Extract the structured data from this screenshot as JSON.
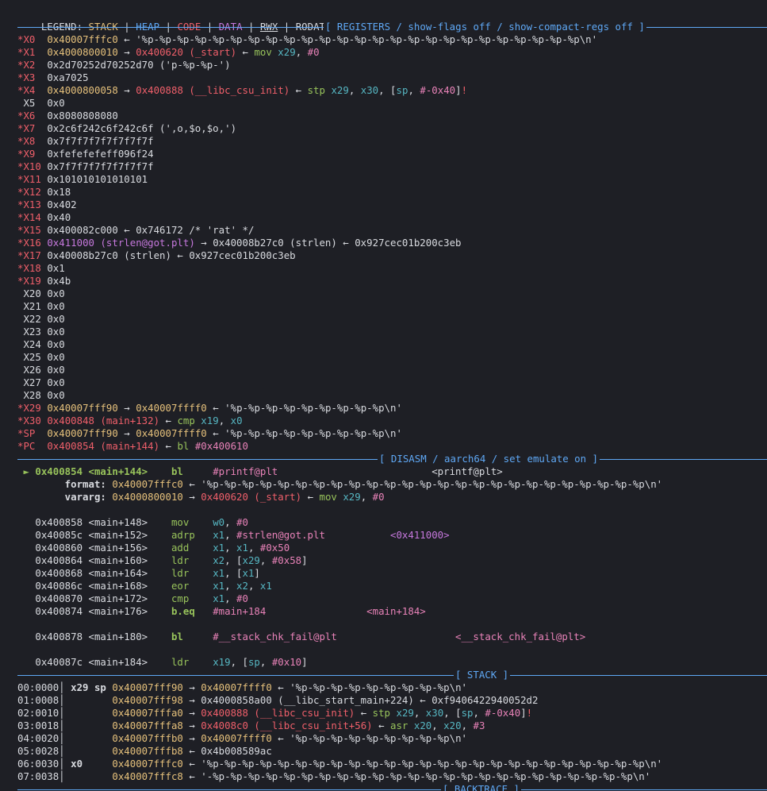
{
  "legend": {
    "label": "LEGEND: ",
    "items": [
      {
        "text": "STACK",
        "color": "#e5c07b"
      },
      {
        "text": "HEAP",
        "color": "#5fa8f5"
      },
      {
        "text": "CODE",
        "color": "#ef5f6a"
      },
      {
        "text": "DATA",
        "color": "#c678dd"
      },
      {
        "text": "RWX",
        "color": "#d9dbe0"
      },
      {
        "text": "RODATA",
        "color": "#d9dbe0"
      }
    ],
    "divider": " | "
  },
  "sections": {
    "registers": "[ REGISTERS / show-flags off / show-compact-regs off ]",
    "disasm": "[ DISASM / aarch64 / set emulate on ]",
    "stack": "[ STACK ]",
    "backtrace": "[ BACKTRACE ]"
  },
  "registers": [
    [
      [
        "*X0  ",
        "red"
      ],
      [
        "0x40007fffc0",
        "yellow"
      ],
      [
        " ← '%p-%p-%p-%p-%p-%p-%p-%p-%p-%p-%p-%p-%p-%p-%p-%p-%p-%p-%p-%p-%p-%p-%p-%p-%p\\n'",
        "white"
      ]
    ],
    [
      [
        "*X1  ",
        "red"
      ],
      [
        "0x4000800010",
        "yellow"
      ],
      [
        " → ",
        "white"
      ],
      [
        "0x400620 (_start)",
        "red"
      ],
      [
        " ← ",
        "white"
      ],
      [
        "mov ",
        "green"
      ],
      [
        "x29",
        "cyan"
      ],
      [
        ", ",
        "white"
      ],
      [
        "#0",
        "pink"
      ]
    ],
    [
      [
        "*X2  ",
        "red"
      ],
      [
        "0x2d70252d70252d70 ('p-%p-%p-')",
        "white"
      ]
    ],
    [
      [
        "*X3  ",
        "red"
      ],
      [
        "0xa7025",
        "white"
      ]
    ],
    [
      [
        "*X4  ",
        "red"
      ],
      [
        "0x4000800058",
        "yellow"
      ],
      [
        " → ",
        "white"
      ],
      [
        "0x400888 (__libc_csu_init)",
        "red"
      ],
      [
        " ← ",
        "white"
      ],
      [
        "stp ",
        "green"
      ],
      [
        "x29",
        "cyan"
      ],
      [
        ", ",
        "white"
      ],
      [
        "x30",
        "cyan"
      ],
      [
        ", [",
        "white"
      ],
      [
        "sp",
        "cyan"
      ],
      [
        ", ",
        "white"
      ],
      [
        "#-0x40",
        "pink"
      ],
      [
        "]",
        "white"
      ],
      [
        "!",
        "red"
      ]
    ],
    [
      [
        " X5  ",
        "white"
      ],
      [
        "0x0",
        "white"
      ]
    ],
    [
      [
        "*X6  ",
        "red"
      ],
      [
        "0x8080808080",
        "white"
      ]
    ],
    [
      [
        "*X7  ",
        "red"
      ],
      [
        "0x2c6f242c6f242c6f (',o,$o,$o,')",
        "white"
      ]
    ],
    [
      [
        "*X8  ",
        "red"
      ],
      [
        "0x7f7f7f7f7f7f7f7f",
        "white"
      ]
    ],
    [
      [
        "*X9  ",
        "red"
      ],
      [
        "0xfefefefeff096f24",
        "white"
      ]
    ],
    [
      [
        "*X10 ",
        "red"
      ],
      [
        "0x7f7f7f7f7f7f7f7f",
        "white"
      ]
    ],
    [
      [
        "*X11 ",
        "red"
      ],
      [
        "0x101010101010101",
        "white"
      ]
    ],
    [
      [
        "*X12 ",
        "red"
      ],
      [
        "0x18",
        "white"
      ]
    ],
    [
      [
        "*X13 ",
        "red"
      ],
      [
        "0x402",
        "white"
      ]
    ],
    [
      [
        "*X14 ",
        "red"
      ],
      [
        "0x40",
        "white"
      ]
    ],
    [
      [
        "*X15 ",
        "red"
      ],
      [
        "0x400082c000 ← 0x746172 /* 'rat' */",
        "white"
      ]
    ],
    [
      [
        "*X16 ",
        "red"
      ],
      [
        "0x411000 (strlen@got.plt)",
        "purple"
      ],
      [
        " → 0x40008b27c0 (strlen) ← 0x927cec01b200c3eb",
        "white"
      ]
    ],
    [
      [
        "*X17 ",
        "red"
      ],
      [
        "0x40008b27c0 (strlen) ← 0x927cec01b200c3eb",
        "white"
      ]
    ],
    [
      [
        "*X18 ",
        "red"
      ],
      [
        "0x1",
        "white"
      ]
    ],
    [
      [
        "*X19 ",
        "red"
      ],
      [
        "0x4b",
        "white"
      ]
    ],
    [
      [
        " X20 ",
        "white"
      ],
      [
        "0x0",
        "white"
      ]
    ],
    [
      [
        " X21 ",
        "white"
      ],
      [
        "0x0",
        "white"
      ]
    ],
    [
      [
        " X22 ",
        "white"
      ],
      [
        "0x0",
        "white"
      ]
    ],
    [
      [
        " X23 ",
        "white"
      ],
      [
        "0x0",
        "white"
      ]
    ],
    [
      [
        " X24 ",
        "white"
      ],
      [
        "0x0",
        "white"
      ]
    ],
    [
      [
        " X25 ",
        "white"
      ],
      [
        "0x0",
        "white"
      ]
    ],
    [
      [
        " X26 ",
        "white"
      ],
      [
        "0x0",
        "white"
      ]
    ],
    [
      [
        " X27 ",
        "white"
      ],
      [
        "0x0",
        "white"
      ]
    ],
    [
      [
        " X28 ",
        "white"
      ],
      [
        "0x0",
        "white"
      ]
    ],
    [
      [
        "*X29 ",
        "red"
      ],
      [
        "0x40007fff90",
        "yellow"
      ],
      [
        " → ",
        "white"
      ],
      [
        "0x40007ffff0",
        "yellow"
      ],
      [
        " ← '%p-%p-%p-%p-%p-%p-%p-%p-%p\\n'",
        "white"
      ]
    ],
    [
      [
        "*X30 ",
        "red"
      ],
      [
        "0x400848 (main+132)",
        "red"
      ],
      [
        " ← ",
        "white"
      ],
      [
        "cmp ",
        "green"
      ],
      [
        "x19",
        "cyan"
      ],
      [
        ", ",
        "white"
      ],
      [
        "x0",
        "cyan"
      ]
    ],
    [
      [
        "*SP  ",
        "red"
      ],
      [
        "0x40007fff90",
        "yellow"
      ],
      [
        " → ",
        "white"
      ],
      [
        "0x40007ffff0",
        "yellow"
      ],
      [
        " ← '%p-%p-%p-%p-%p-%p-%p-%p-%p\\n'",
        "white"
      ]
    ],
    [
      [
        "*PC  ",
        "red"
      ],
      [
        "0x400854 (main+144)",
        "red"
      ],
      [
        " ← ",
        "white"
      ],
      [
        "bl ",
        "green"
      ],
      [
        "#0x400610",
        "pink"
      ]
    ]
  ],
  "disasm": [
    {
      "segs": [
        [
          " ► 0x400854 <main+144>    bl     ",
          "green-bold"
        ],
        [
          "#printf@plt",
          "pink"
        ],
        [
          "                          ",
          "white"
        ],
        [
          "<printf@plt>",
          "white"
        ]
      ]
    },
    {
      "segs": [
        [
          "        format: ",
          "white-bold"
        ],
        [
          "0x40007fffc0",
          "yellow"
        ],
        [
          " ← '%p-%p-%p-%p-%p-%p-%p-%p-%p-%p-%p-%p-%p-%p-%p-%p-%p-%p-%p-%p-%p-%p-%p-%p-%p\\n'",
          "white"
        ]
      ]
    },
    {
      "segs": [
        [
          "        vararg: ",
          "white-bold"
        ],
        [
          "0x4000800010",
          "yellow"
        ],
        [
          " → ",
          "white"
        ],
        [
          "0x400620 (_start)",
          "red"
        ],
        [
          " ← ",
          "white"
        ],
        [
          "mov ",
          "green"
        ],
        [
          "x29",
          "cyan"
        ],
        [
          ", ",
          "white"
        ],
        [
          "#0",
          "pink"
        ]
      ]
    },
    {
      "segs": []
    },
    {
      "segs": [
        [
          "   0x400858 <main+148>    ",
          "white"
        ],
        [
          "mov    ",
          "green"
        ],
        [
          "w0",
          "cyan"
        ],
        [
          ", ",
          "white"
        ],
        [
          "#0",
          "pink"
        ]
      ]
    },
    {
      "segs": [
        [
          "   0x40085c <main+152>    ",
          "white"
        ],
        [
          "adrp   ",
          "green"
        ],
        [
          "x1",
          "cyan"
        ],
        [
          ", ",
          "white"
        ],
        [
          "#strlen@got.plt",
          "pink"
        ],
        [
          "           ",
          "white"
        ],
        [
          "<0x411000>",
          "purple"
        ]
      ]
    },
    {
      "segs": [
        [
          "   0x400860 <main+156>    ",
          "white"
        ],
        [
          "add    ",
          "green"
        ],
        [
          "x1",
          "cyan"
        ],
        [
          ", ",
          "white"
        ],
        [
          "x1",
          "cyan"
        ],
        [
          ", ",
          "white"
        ],
        [
          "#0x50",
          "pink"
        ]
      ]
    },
    {
      "segs": [
        [
          "   0x400864 <main+160>    ",
          "white"
        ],
        [
          "ldr    ",
          "green"
        ],
        [
          "x2",
          "cyan"
        ],
        [
          ", [",
          "white"
        ],
        [
          "x29",
          "cyan"
        ],
        [
          ", ",
          "white"
        ],
        [
          "#0x58",
          "pink"
        ],
        [
          "]",
          "white"
        ]
      ]
    },
    {
      "segs": [
        [
          "   0x400868 <main+164>    ",
          "white"
        ],
        [
          "ldr    ",
          "green"
        ],
        [
          "x1",
          "cyan"
        ],
        [
          ", [",
          "white"
        ],
        [
          "x1",
          "cyan"
        ],
        [
          "]",
          "white"
        ]
      ]
    },
    {
      "segs": [
        [
          "   0x40086c <main+168>    ",
          "white"
        ],
        [
          "eor    ",
          "green"
        ],
        [
          "x1",
          "cyan"
        ],
        [
          ", ",
          "white"
        ],
        [
          "x2",
          "cyan"
        ],
        [
          ", ",
          "white"
        ],
        [
          "x1",
          "cyan"
        ]
      ]
    },
    {
      "segs": [
        [
          "   0x400870 <main+172>    ",
          "white"
        ],
        [
          "cmp    ",
          "green"
        ],
        [
          "x1",
          "cyan"
        ],
        [
          ", ",
          "white"
        ],
        [
          "#0",
          "pink"
        ]
      ]
    },
    {
      "segs": [
        [
          "   0x400874 <main+176>    ",
          "white"
        ],
        [
          "b.eq   ",
          "green-bold"
        ],
        [
          "#main+184",
          "pink"
        ],
        [
          "                 ",
          "white"
        ],
        [
          "<main+184>",
          "pink"
        ]
      ]
    },
    {
      "segs": []
    },
    {
      "segs": [
        [
          "   0x400878 <main+180>    ",
          "white"
        ],
        [
          "bl     ",
          "green-bold"
        ],
        [
          "#__stack_chk_fail@plt",
          "pink"
        ],
        [
          "                    ",
          "white"
        ],
        [
          "<__stack_chk_fail@plt>",
          "pink"
        ]
      ]
    },
    {
      "segs": []
    },
    {
      "segs": [
        [
          "   0x40087c <main+184>    ",
          "white"
        ],
        [
          "ldr    ",
          "green"
        ],
        [
          "x19",
          "cyan"
        ],
        [
          ", [",
          "white"
        ],
        [
          "sp",
          "cyan"
        ],
        [
          ", ",
          "white"
        ],
        [
          "#0x10",
          "pink"
        ],
        [
          "]",
          "white"
        ]
      ]
    }
  ],
  "stack": [
    [
      [
        "00:0000",
        "white"
      ],
      [
        "│ x29 sp ",
        "white-bold"
      ],
      [
        "0x40007fff90",
        "yellow"
      ],
      [
        " → ",
        "white"
      ],
      [
        "0x40007ffff0",
        "yellow"
      ],
      [
        " ← '%p-%p-%p-%p-%p-%p-%p-%p-%p\\n'",
        "white"
      ]
    ],
    [
      [
        "01:0008",
        "white"
      ],
      [
        "│        ",
        "white"
      ],
      [
        "0x40007fff98",
        "yellow"
      ],
      [
        " → 0x4000858a00 (__libc_start_main+224) ← 0xf9406422940052d2",
        "white"
      ]
    ],
    [
      [
        "02:0010",
        "white"
      ],
      [
        "│        ",
        "white"
      ],
      [
        "0x40007fffa0",
        "yellow"
      ],
      [
        " → ",
        "white"
      ],
      [
        "0x400888 (__libc_csu_init)",
        "red"
      ],
      [
        " ← ",
        "white"
      ],
      [
        "stp ",
        "green"
      ],
      [
        "x29",
        "cyan"
      ],
      [
        ", ",
        "white"
      ],
      [
        "x30",
        "cyan"
      ],
      [
        ", [",
        "white"
      ],
      [
        "sp",
        "cyan"
      ],
      [
        ", ",
        "white"
      ],
      [
        "#-0x40",
        "pink"
      ],
      [
        "]",
        "white"
      ],
      [
        "!",
        "red"
      ]
    ],
    [
      [
        "03:0018",
        "white"
      ],
      [
        "│        ",
        "white"
      ],
      [
        "0x40007fffa8",
        "yellow"
      ],
      [
        " → ",
        "white"
      ],
      [
        "0x4008c0 (__libc_csu_init+56)",
        "red"
      ],
      [
        " ← ",
        "white"
      ],
      [
        "asr ",
        "green"
      ],
      [
        "x20",
        "cyan"
      ],
      [
        ", ",
        "white"
      ],
      [
        "x20",
        "cyan"
      ],
      [
        ", ",
        "white"
      ],
      [
        "#3",
        "pink"
      ]
    ],
    [
      [
        "04:0020",
        "white"
      ],
      [
        "│        ",
        "white"
      ],
      [
        "0x40007fffb0",
        "yellow"
      ],
      [
        " → ",
        "white"
      ],
      [
        "0x40007ffff0",
        "yellow"
      ],
      [
        " ← '%p-%p-%p-%p-%p-%p-%p-%p-%p\\n'",
        "white"
      ]
    ],
    [
      [
        "05:0028",
        "white"
      ],
      [
        "│        ",
        "white"
      ],
      [
        "0x40007fffb8",
        "yellow"
      ],
      [
        " ← 0x4b008589ac",
        "white"
      ]
    ],
    [
      [
        "06:0030",
        "white"
      ],
      [
        "│ x0     ",
        "white-bold"
      ],
      [
        "0x40007fffc0",
        "yellow"
      ],
      [
        " ← '%p-%p-%p-%p-%p-%p-%p-%p-%p-%p-%p-%p-%p-%p-%p-%p-%p-%p-%p-%p-%p-%p-%p-%p-%p\\n'",
        "white"
      ]
    ],
    [
      [
        "07:0038",
        "white"
      ],
      [
        "│        ",
        "white"
      ],
      [
        "0x40007fffc8",
        "yellow"
      ],
      [
        " ← '-%p-%p-%p-%p-%p-%p-%p-%p-%p-%p-%p-%p-%p-%p-%p-%p-%p-%p-%p-%p-%p-%p-%p-%p\\n'",
        "white"
      ]
    ]
  ]
}
